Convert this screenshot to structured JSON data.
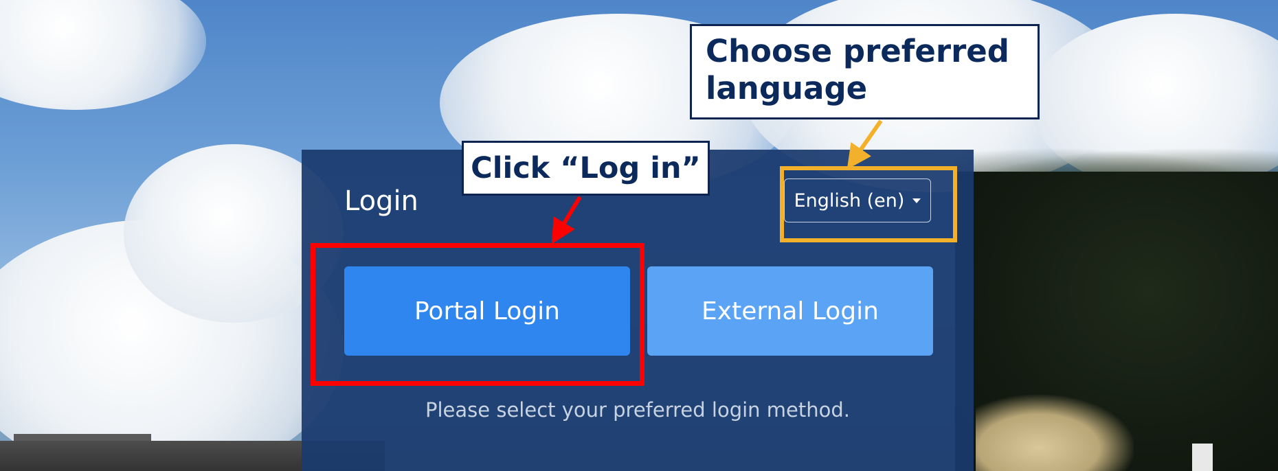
{
  "login_panel": {
    "title": "Login",
    "language_selector": {
      "selected": "English (en)",
      "icon": "chevron-down-icon"
    },
    "buttons": {
      "portal": "Portal Login",
      "external": "External Login"
    },
    "helper_text": "Please select your preferred login method."
  },
  "annotations": {
    "language_callout": "Choose preferred language",
    "login_callout": "Click “Log in”"
  },
  "colors": {
    "panel_bg": "#1a3a6e",
    "portal_button": "#2e86ee",
    "external_button": "#5aa3f5",
    "highlight_red": "#ff0000",
    "highlight_orange": "#f3b12b",
    "callout_text": "#0b2a5b"
  }
}
